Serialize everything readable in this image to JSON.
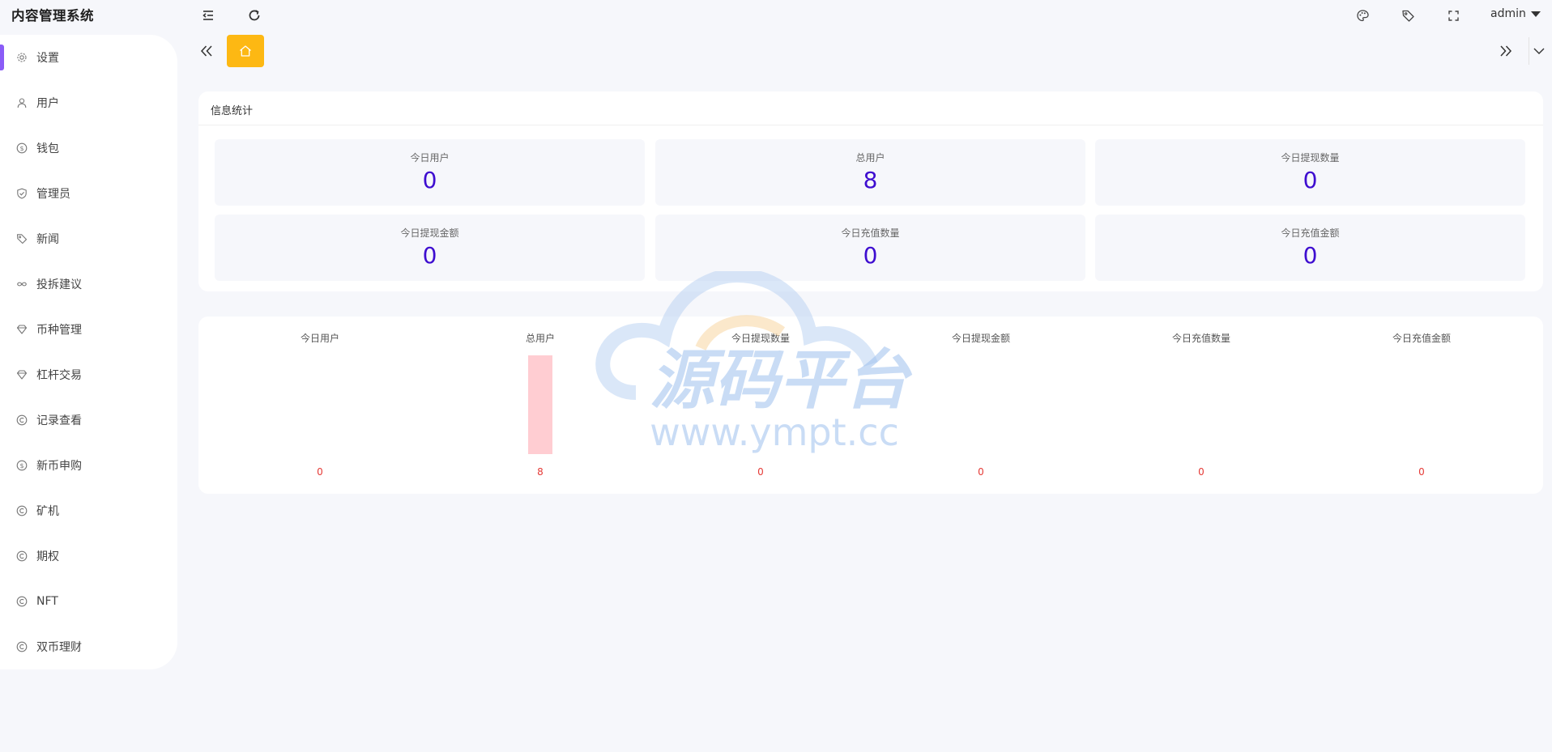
{
  "app": {
    "title": "内容管理系统"
  },
  "header": {
    "user_name": "admin"
  },
  "sidebar": {
    "items": [
      {
        "label": "设置",
        "icon": "gear-icon",
        "active": true
      },
      {
        "label": "用户",
        "icon": "user-icon"
      },
      {
        "label": "钱包",
        "icon": "dollar-circle-icon"
      },
      {
        "label": "管理员",
        "icon": "shield-check-icon"
      },
      {
        "label": "新闻",
        "icon": "tag-icon"
      },
      {
        "label": "投拆建议",
        "icon": "infinity-icon"
      },
      {
        "label": "币种管理",
        "icon": "diamond-icon"
      },
      {
        "label": "杠杆交易",
        "icon": "diamond-icon"
      },
      {
        "label": "记录查看",
        "icon": "circle-c-icon"
      },
      {
        "label": "新币申购",
        "icon": "dollar-circle-icon"
      },
      {
        "label": "矿机",
        "icon": "circle-c-icon"
      },
      {
        "label": "期权",
        "icon": "circle-c-icon"
      },
      {
        "label": "NFT",
        "icon": "circle-c-icon"
      },
      {
        "label": "双币理财",
        "icon": "circle-c-icon"
      }
    ]
  },
  "stats": {
    "title": "信息统计",
    "items": [
      {
        "label": "今日用户",
        "value": "0"
      },
      {
        "label": "总用户",
        "value": "8"
      },
      {
        "label": "今日提现数量",
        "value": "0"
      },
      {
        "label": "今日提现金额",
        "value": "0"
      },
      {
        "label": "今日充值数量",
        "value": "0"
      },
      {
        "label": "今日充值金额",
        "value": "0"
      }
    ]
  },
  "chart_data": {
    "type": "bar",
    "categories": [
      "今日用户",
      "总用户",
      "今日提现数量",
      "今日提现金额",
      "今日充值数量",
      "今日充值金额"
    ],
    "values": [
      0,
      8,
      0,
      0,
      0,
      0
    ],
    "value_labels": [
      "0",
      "8",
      "0",
      "0",
      "0",
      "0"
    ],
    "title": "",
    "xlabel": "",
    "ylabel": "",
    "grid": false,
    "bar_color": "#ffcdd2",
    "value_label_color": "#e53935"
  },
  "watermark": {
    "text": "源码平台",
    "url": "www.ympt.cc"
  },
  "colors": {
    "accent": "#8a5cf7",
    "home_tab": "#fdb813",
    "stat_value": "#3e0dd0"
  }
}
